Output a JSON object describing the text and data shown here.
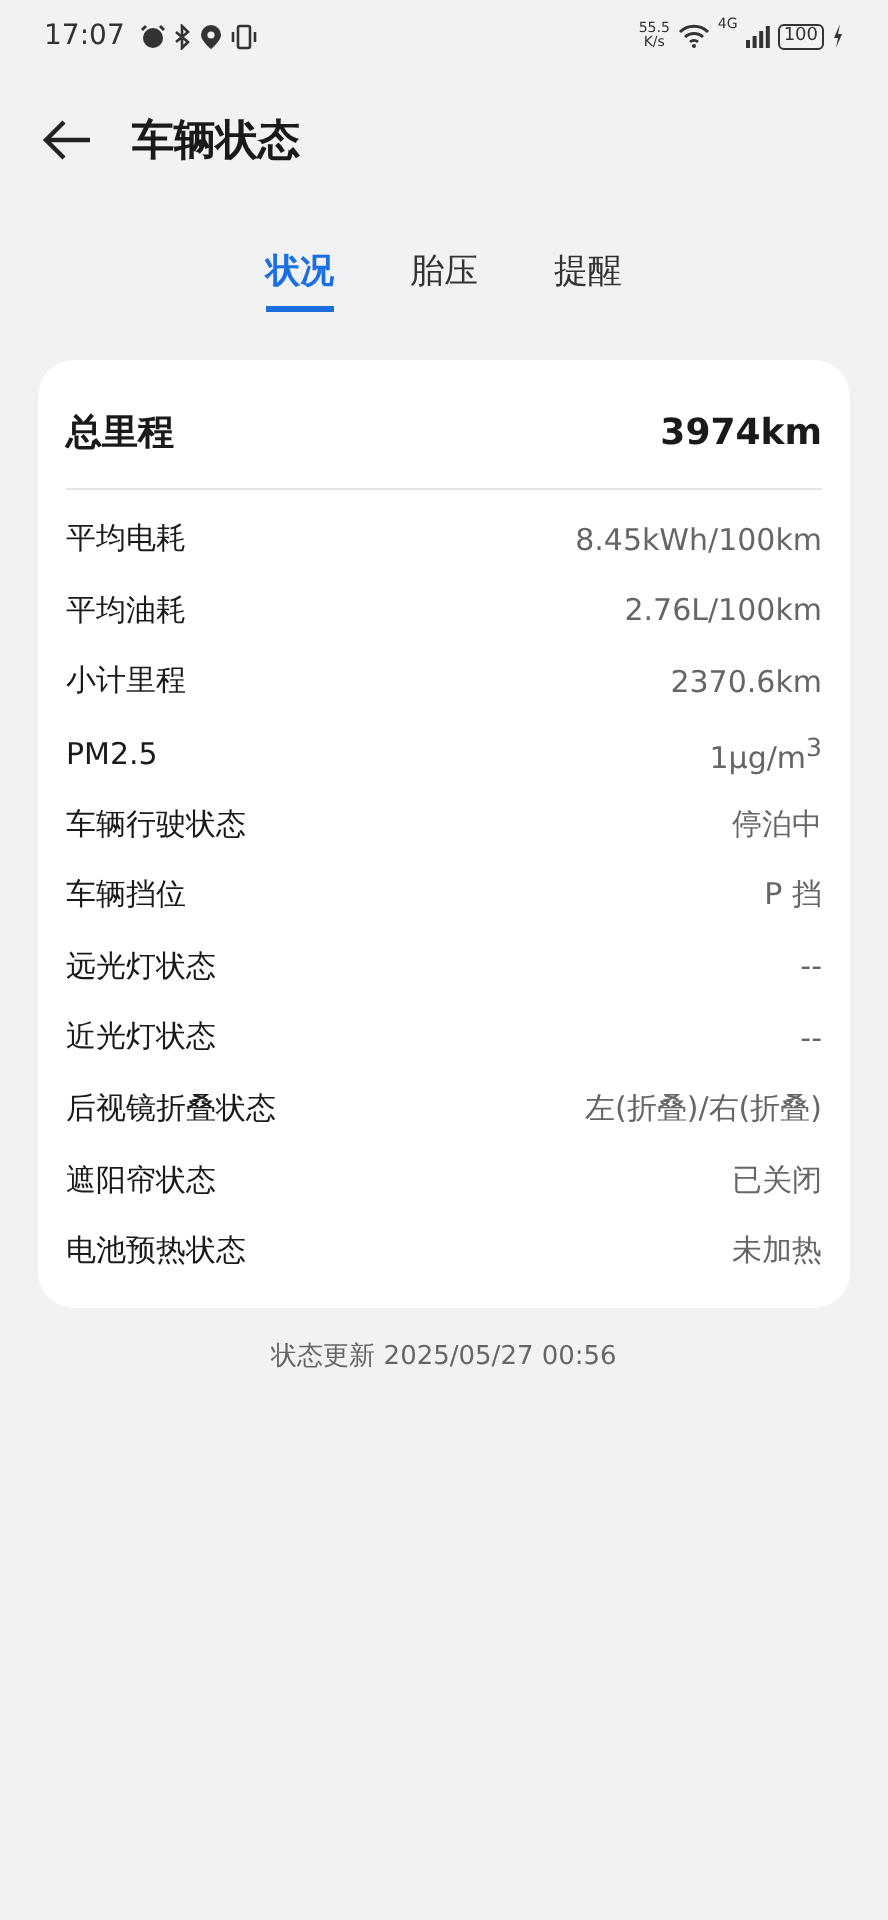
{
  "status_bar": {
    "time": "17:07",
    "speed": "55.5",
    "speed_unit": "K/s",
    "network": "4G",
    "battery": "100"
  },
  "header": {
    "title": "车辆状态"
  },
  "tabs": [
    {
      "label": "状况",
      "selected": true
    },
    {
      "label": "胎压",
      "selected": false
    },
    {
      "label": "提醒",
      "selected": false
    }
  ],
  "summary": {
    "label": "总里程",
    "value": "3974km"
  },
  "rows": [
    {
      "label": "平均电耗",
      "value": "8.45kWh/100km"
    },
    {
      "label": "平均油耗",
      "value": "2.76L/100km"
    },
    {
      "label": "小计里程",
      "value": "2370.6km"
    },
    {
      "label": "PM2.5",
      "value": "1μg/m$^{3}$"
    },
    {
      "label": "车辆行驶状态",
      "value": "停泊中"
    },
    {
      "label": "车辆挡位",
      "value": "P 挡"
    },
    {
      "label": "远光灯状态",
      "value": "--"
    },
    {
      "label": "近光灯状态",
      "value": "--"
    },
    {
      "label": "后视镜折叠状态",
      "value": "左(折叠)/右(折叠)"
    },
    {
      "label": "遮阳帘状态",
      "value": "已关闭"
    },
    {
      "label": "电池预热状态",
      "value": "未加热"
    }
  ],
  "updated": "状态更新 2025/05/27 00:56"
}
